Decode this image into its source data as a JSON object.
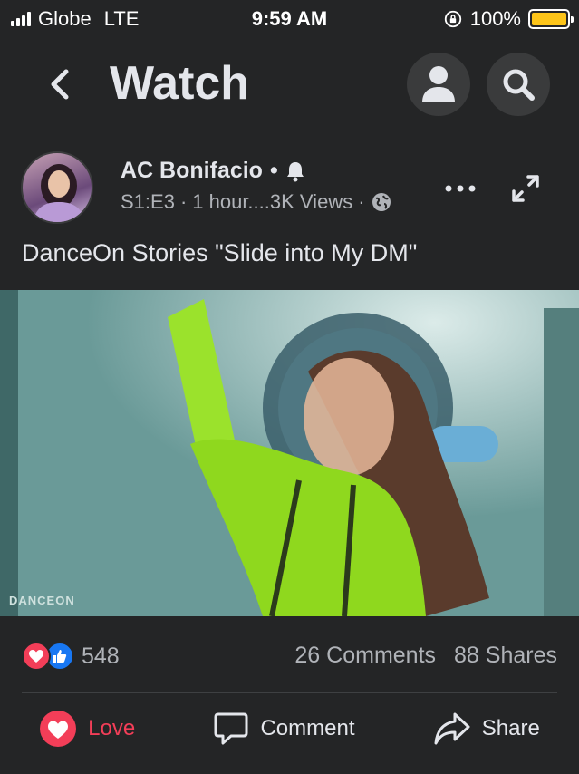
{
  "status_bar": {
    "carrier": "Globe",
    "network": "LTE",
    "time": "9:59 AM",
    "battery": "100%",
    "battery_level": 1.0,
    "battery_color": "#fcc419"
  },
  "header": {
    "title": "Watch",
    "back_icon": "chevron-left-icon",
    "profile_icon": "person-icon",
    "search_icon": "search-icon"
  },
  "post": {
    "author": "AC Bonifacio",
    "separator": "•",
    "meta_episode": "S1:E3",
    "meta_dot": "·",
    "meta_rest": "1 hour....3K Views",
    "meta_dot2": "·",
    "text": "DanceOn Stories \"Slide into My DM\"",
    "video_watermark": "DANCEON",
    "reaction_count": "548",
    "comments": "26 Comments",
    "shares": "88 Shares"
  },
  "actions": {
    "love": "Love",
    "comment": "Comment",
    "share": "Share"
  },
  "colors": {
    "love": "#f33e58",
    "like": "#1877f2",
    "background": "#242526"
  }
}
